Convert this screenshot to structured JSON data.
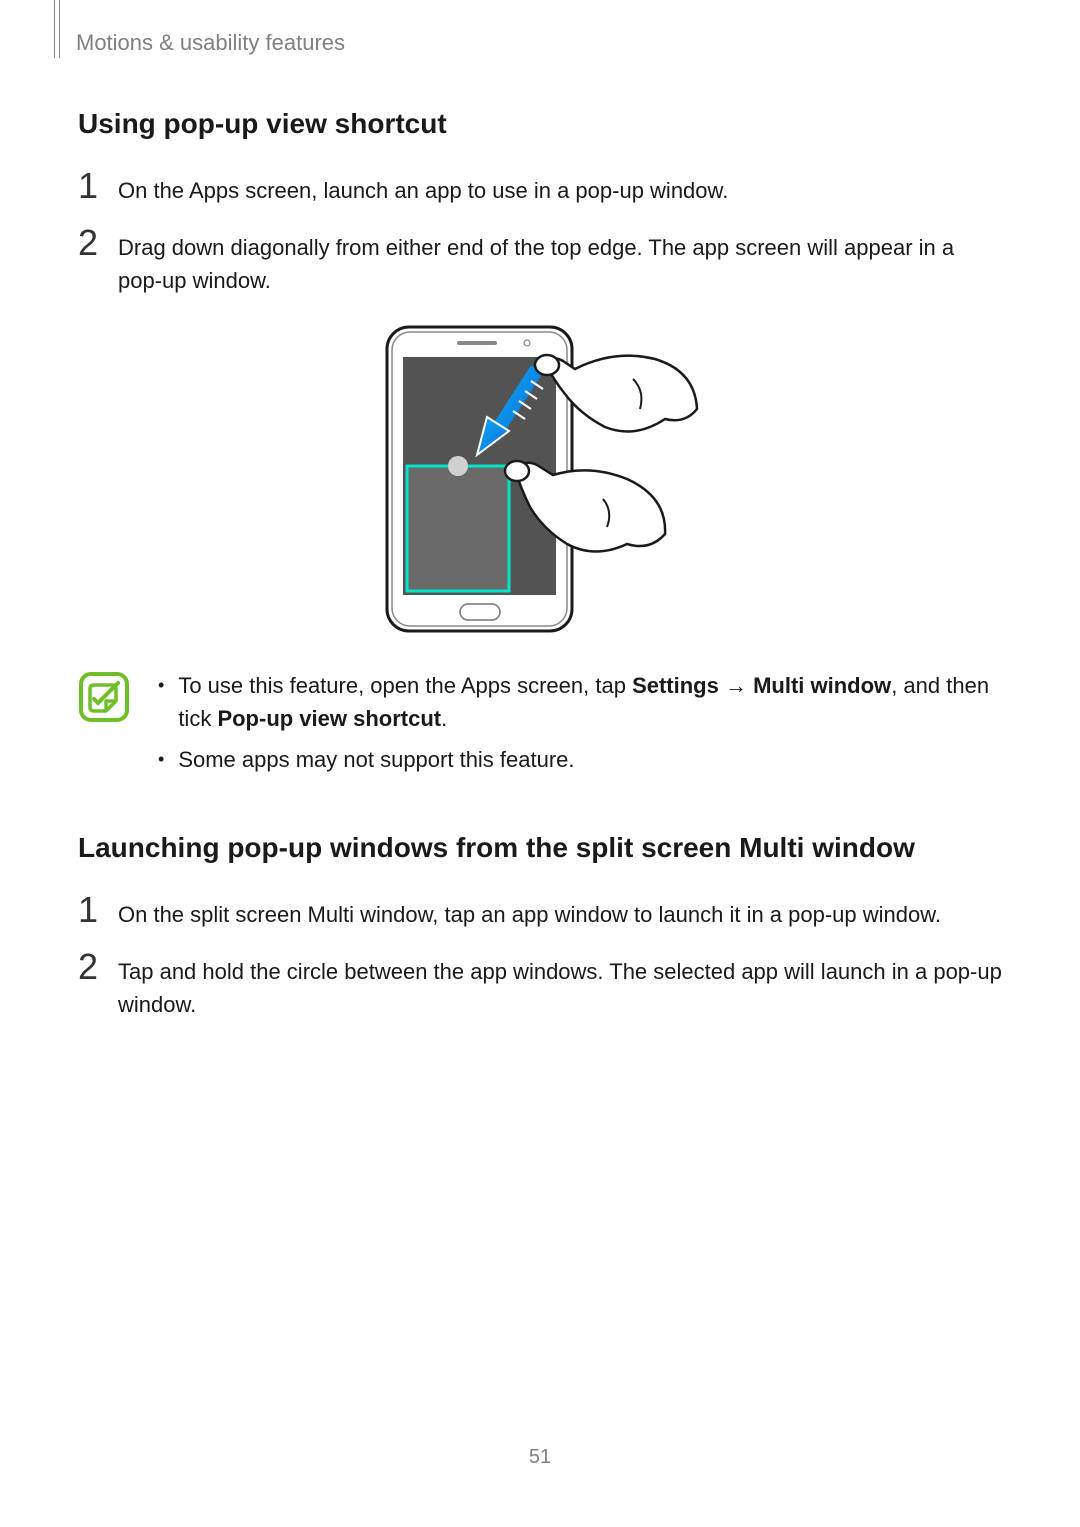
{
  "breadcrumb": "Motions & usability features",
  "section1": {
    "heading": "Using pop-up view shortcut",
    "steps": [
      {
        "num": "1",
        "text": "On the Apps screen, launch an app to use in a pop-up window."
      },
      {
        "num": "2",
        "text": "Drag down diagonally from either end of the top edge. The app screen will appear in a pop-up window."
      }
    ]
  },
  "note": {
    "bullets": [
      {
        "pre": "To use this feature, open the Apps screen, tap ",
        "bold1": "Settings",
        "arrow": " → ",
        "bold2": "Multi window",
        "mid": ", and then tick ",
        "bold3": "Pop-up view shortcut",
        "post": "."
      },
      {
        "plain": "Some apps may not support this feature."
      }
    ]
  },
  "section2": {
    "heading": "Launching pop-up windows from the split screen Multi window",
    "steps": [
      {
        "num": "1",
        "text": "On the split screen Multi window, tap an app window to launch it in a pop-up window."
      },
      {
        "num": "2",
        "text": "Tap and hold the circle between the app windows. The selected app will launch in a pop-up window."
      }
    ]
  },
  "pageNumber": "51"
}
